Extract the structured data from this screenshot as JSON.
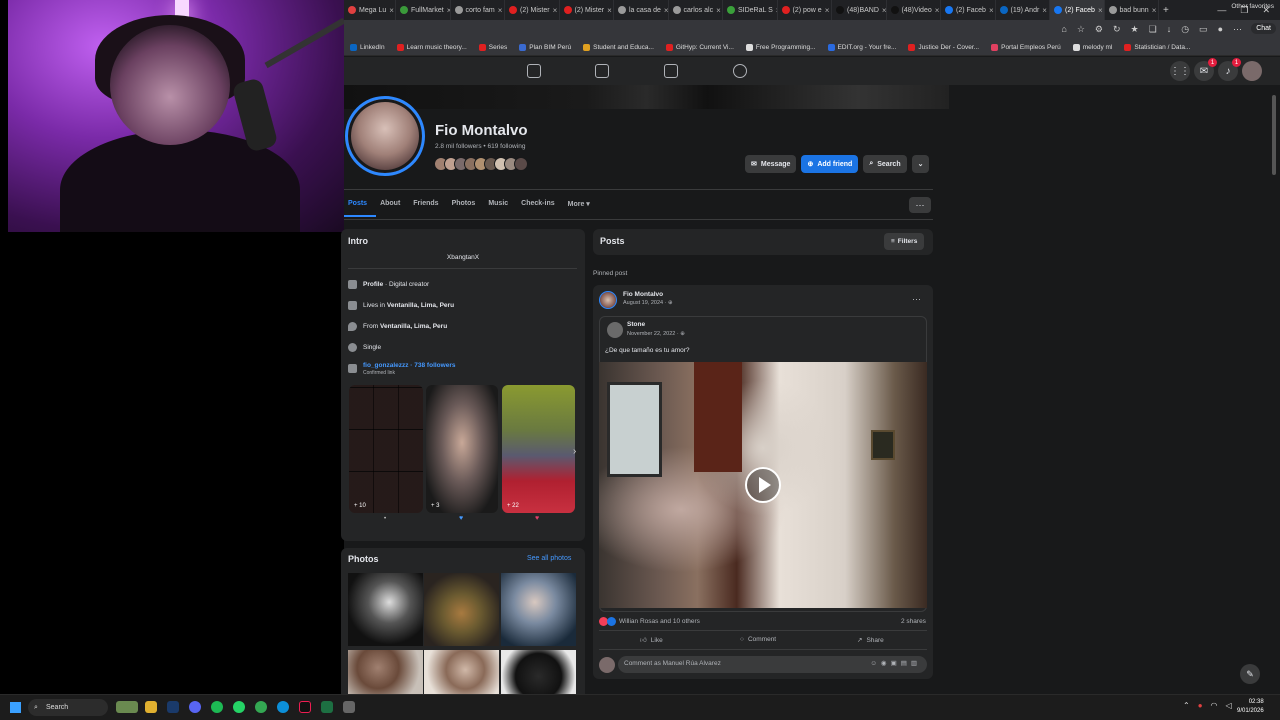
{
  "browser": {
    "tabs": [
      {
        "label": "Mega Lu",
        "color": "#e04040"
      },
      {
        "label": "FullMarket",
        "color": "#3a9a3a"
      },
      {
        "label": "corto fam",
        "color": "#9a9a9a"
      },
      {
        "label": "(2) Mister",
        "color": "#e02020"
      },
      {
        "label": "(2) Mister",
        "color": "#e02020"
      },
      {
        "label": "la casa de",
        "color": "#9a9a9a"
      },
      {
        "label": "carlos alc",
        "color": "#9a9a9a"
      },
      {
        "label": "SIDeRaL S",
        "color": "#3aa03a"
      },
      {
        "label": "(2) pow e",
        "color": "#e02020"
      },
      {
        "label": "(48)BAND",
        "color": "#111111"
      },
      {
        "label": "(48)Video",
        "color": "#111111"
      },
      {
        "label": "(2) Faceb",
        "color": "#1877f2"
      },
      {
        "label": "(19) Andr",
        "color": "#0a66c2"
      },
      {
        "label": "(2) Faceb",
        "color": "#1877f2"
      },
      {
        "label": "bad bunn",
        "color": "#9a9a9a"
      }
    ],
    "active_tab_index": 13,
    "new_tab": "+",
    "chat_label": "Chat",
    "bookmarks": [
      {
        "label": "LinkedIn",
        "color": "#0a66c2"
      },
      {
        "label": "Learn music theory...",
        "color": "#e02020"
      },
      {
        "label": "Series",
        "color": "#e02020"
      },
      {
        "label": "Plan BIM Perú",
        "color": "#3a6ad0"
      },
      {
        "label": "Student and Educa...",
        "color": "#e0a020"
      },
      {
        "label": "GitHyp: Current Vi...",
        "color": "#e02020"
      },
      {
        "label": "Free Programming...",
        "color": "#dddddd"
      },
      {
        "label": "EDIT.org - Your fre...",
        "color": "#2a6ae0"
      },
      {
        "label": "Justice Der - Cover...",
        "color": "#e02020"
      },
      {
        "label": "Portal Empleos Perú",
        "color": "#e04060"
      },
      {
        "label": "melody ml",
        "color": "#dddddd"
      },
      {
        "label": "Statistician / Data...",
        "color": "#e02020"
      }
    ],
    "other_favorites": "Other favorites"
  },
  "fb_nav": {
    "messenger_badge": "1",
    "notif_badge": "1"
  },
  "profile": {
    "name": "Fio Montalvo",
    "stats": "2.8 mil followers • 619 following",
    "friend_avatar_colors": [
      "#a08070",
      "#c0a090",
      "#7a6a6a",
      "#8a7060",
      "#b09070",
      "#6a5a50",
      "#d0c0b0",
      "#9a8a80",
      "#5a4a48"
    ],
    "buttons": {
      "message": "Message",
      "add_friend": "Add friend",
      "search": "Search"
    }
  },
  "profile_tabs": [
    "Posts",
    "About",
    "Friends",
    "Photos",
    "Music",
    "Check-ins",
    "More ▾"
  ],
  "intro": {
    "title": "Intro",
    "bio": "XbangtanX",
    "rows": [
      {
        "pre": "",
        "bold": "Profile",
        "post": " · Digital creator"
      },
      {
        "pre": "Lives in ",
        "bold": "Ventanilla, Lima, Peru",
        "post": ""
      },
      {
        "pre": "From ",
        "bold": "Ventanilla, Lima, Peru",
        "post": ""
      },
      {
        "pre": "Single",
        "bold": "",
        "post": ""
      }
    ],
    "link": {
      "text": "fio_gonzalezzz · 738 followers",
      "sub": "Confirmed link"
    },
    "featured": [
      {
        "count": "+ 10"
      },
      {
        "count": "+ 3"
      },
      {
        "count": "+ 22"
      }
    ]
  },
  "photos": {
    "title": "Photos",
    "see_all": "See all photos"
  },
  "posts": {
    "title": "Posts",
    "filters": "Filters",
    "pinned": "Pinned post",
    "author": "Fio Montalvo",
    "date": "August 19, 2024 · ⊕",
    "shared_author": "Stone",
    "shared_date": "November 22, 2022 · ⊕",
    "caption": "¿De que tamaño es tu amor?",
    "reactions": "Willian Rosas and 10 others",
    "shares": "2 shares",
    "like": "Like",
    "comment": "Comment",
    "share": "Share",
    "comment_placeholder": "Comment as Manuel Rúa Alvarez"
  },
  "taskbar": {
    "search": "Search",
    "time": "02:38",
    "date": "9/01/2026"
  }
}
